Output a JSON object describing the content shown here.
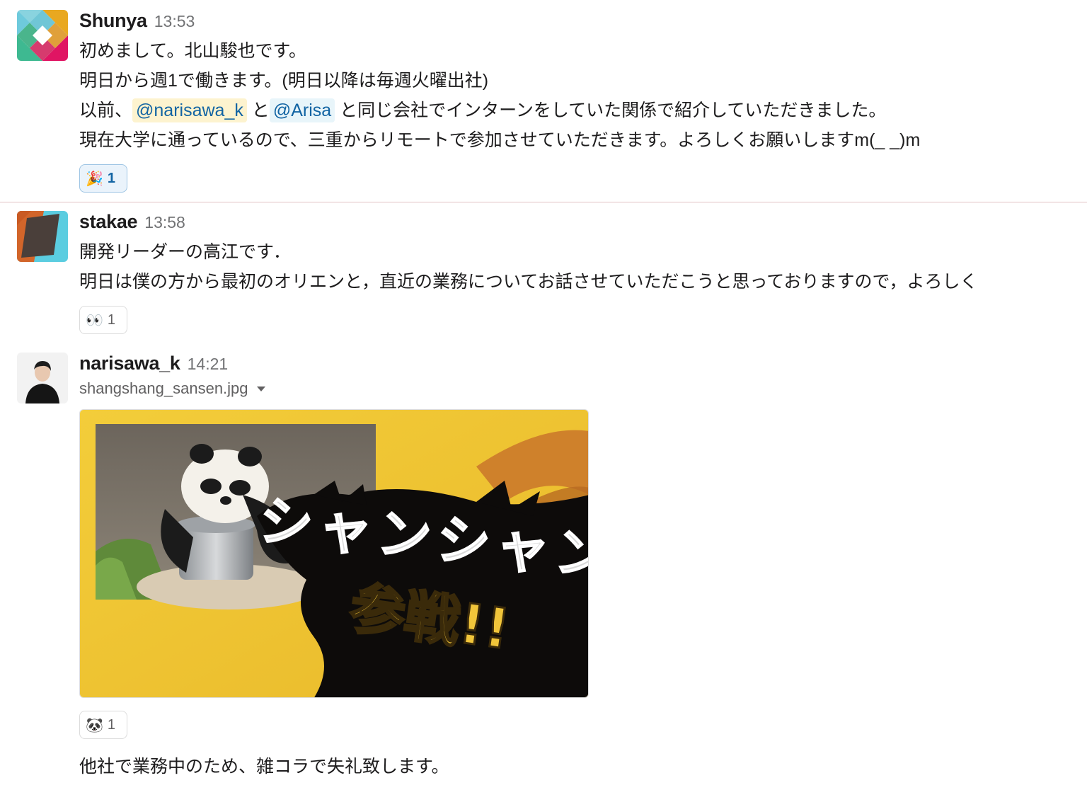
{
  "messages": [
    {
      "username": "Shunya",
      "time": "13:53",
      "lines": {
        "l1": "初めまして。北山駿也です。",
        "l2": "明日から週1で働きます。(明日以降は毎週火曜出社)",
        "l3_pre": "以前、",
        "mention1": "@narisawa_k",
        "l3_mid": " と",
        "mention2": "@Arisa",
        "l3_post": " と同じ会社でインターンをしていた関係で紹介していただきました。",
        "l4": "現在大学に通っているので、三重からリモートで参加させていただきます。よろしくお願いしますm(_ _)m"
      },
      "reaction": {
        "emoji": "🎉",
        "emoji_name": "tada-icon",
        "count": "1"
      }
    },
    {
      "username": "stakae",
      "time": "13:58",
      "lines": {
        "l1": "開発リーダーの高江です．",
        "l2": "明日は僕の方から最初のオリエンと，直近の業務についてお話させていただこうと思っておりますので，よろしく"
      },
      "reaction": {
        "emoji": "👀",
        "emoji_name": "eyes-icon",
        "count": "1"
      }
    },
    {
      "username": "narisawa_k",
      "time": "14:21",
      "file_name": "shangshang_sansen.jpg",
      "image_text": {
        "line1": "シャンシャン",
        "line2": "参戦!!"
      },
      "reaction": {
        "emoji": "🐼",
        "emoji_name": "panda-icon",
        "count": "1"
      },
      "follow_up": "他社で業務中のため、雑コラで失礼致します。"
    }
  ],
  "colors": {
    "mention_text": "#1264a3",
    "mention_highlight_bg": "#fdf3cf",
    "mention_bg": "#e8f5fa",
    "timestamp": "#717274",
    "divider": "#e2c2c5"
  }
}
